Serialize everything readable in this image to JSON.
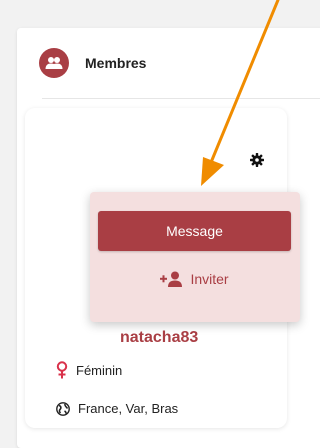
{
  "panel": {
    "title": "Membres",
    "icon": "group-icon",
    "accent_color": "#a93e44"
  },
  "member_card": {
    "username": "natacha83",
    "gender": "Féminin",
    "gender_icon": "female-icon",
    "location": "France, Var, Bras",
    "location_icon": "globe-icon",
    "settings_icon": "gear-icon"
  },
  "popup_menu": {
    "message_label": "Message",
    "invite_label": "Inviter",
    "invite_icon": "add-person-icon"
  },
  "annotation": {
    "arrow_color": "#f08c00"
  }
}
